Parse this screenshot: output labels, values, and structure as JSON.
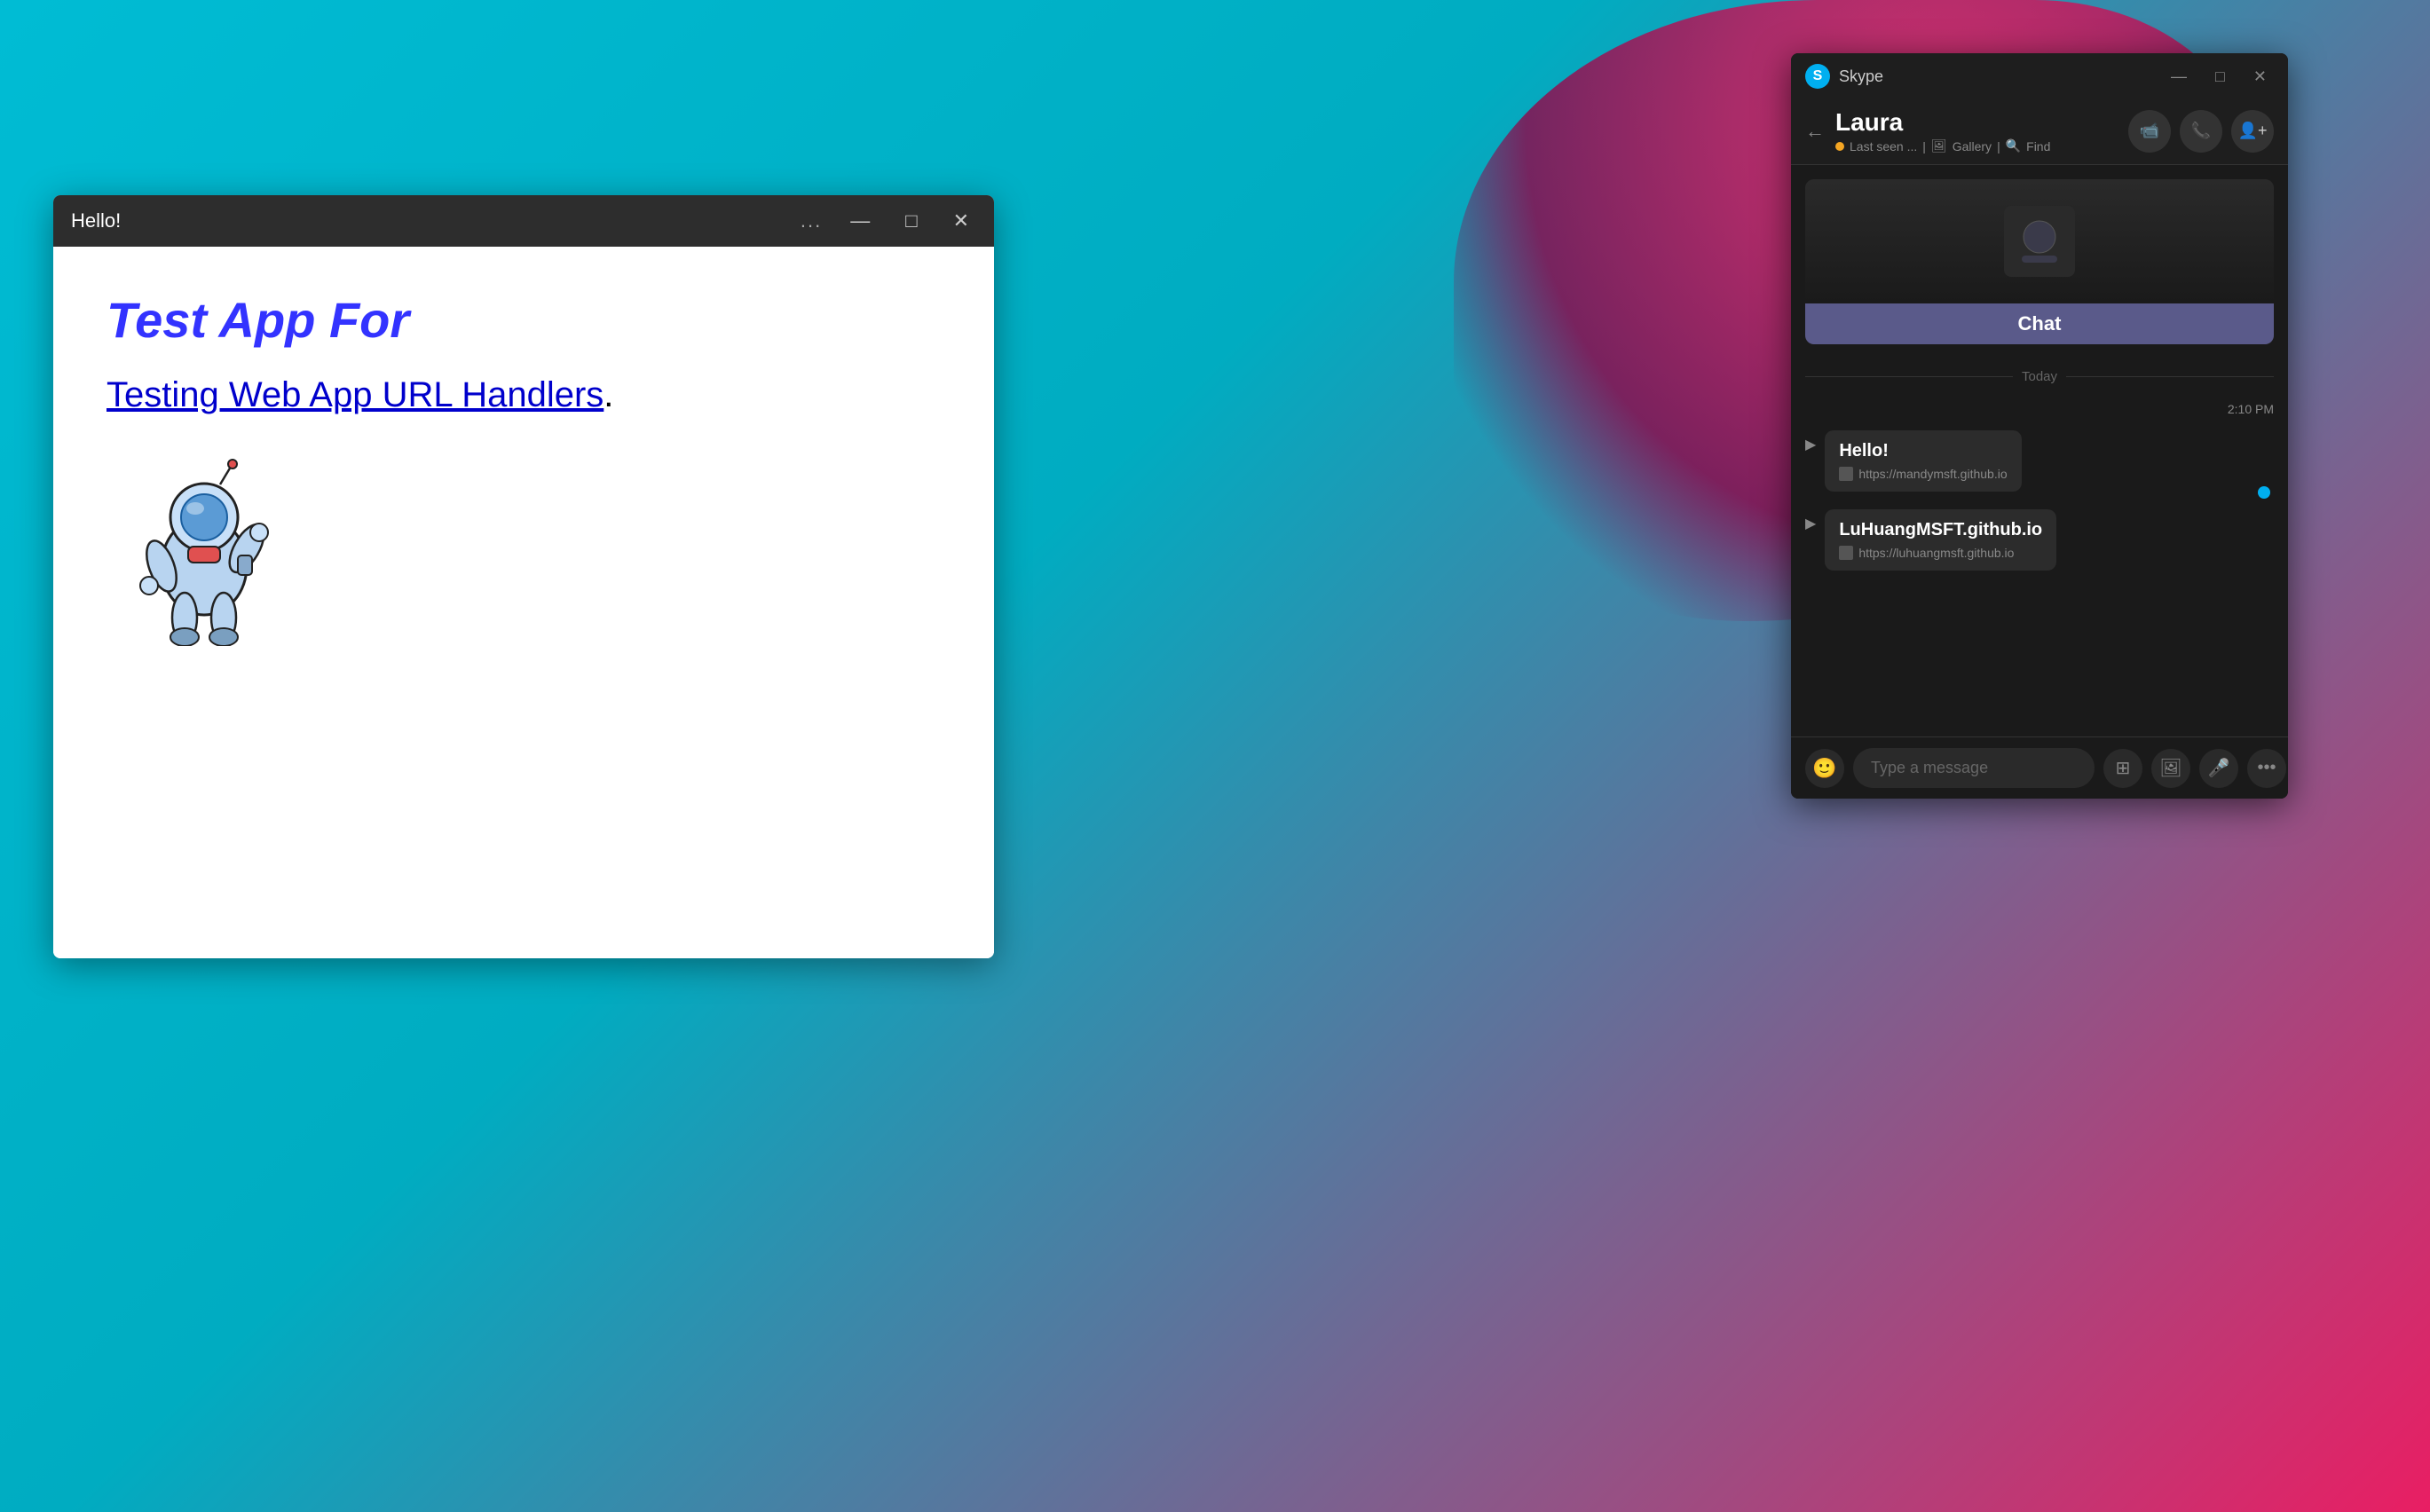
{
  "desktop": {
    "bg_description": "Teal and floral desktop background"
  },
  "webapp": {
    "title": "Hello!",
    "heading": "Test App For",
    "link_text": "Testing Web App URL Handlers",
    "link_period": ".",
    "controls": {
      "dots": "...",
      "minimize": "—",
      "maximize": "□",
      "close": "✕"
    }
  },
  "skype": {
    "app_title": "Skype",
    "logo_letter": "S",
    "window_controls": {
      "minimize": "—",
      "maximize": "□",
      "close": "✕"
    },
    "header": {
      "contact_name": "Laura",
      "status": "Last seen ...",
      "status_separator": "|",
      "gallery": "Gallery",
      "find": "Find",
      "back_arrow": "←"
    },
    "chat_promo": {
      "label": "Chat"
    },
    "day_divider": "Today",
    "time_stamp": "2:10 PM",
    "messages": [
      {
        "title": "Hello!",
        "link": "https://mandymsft.github.io"
      },
      {
        "title": "LuHuangMSFT.github.io",
        "link": "https://luhuangmsft.github.io"
      }
    ],
    "input": {
      "placeholder": "Type a message"
    },
    "input_actions": {
      "emoji": "🙂",
      "attach": "⬛",
      "image": "🖼",
      "mic": "🎤",
      "more": "⋯"
    }
  }
}
